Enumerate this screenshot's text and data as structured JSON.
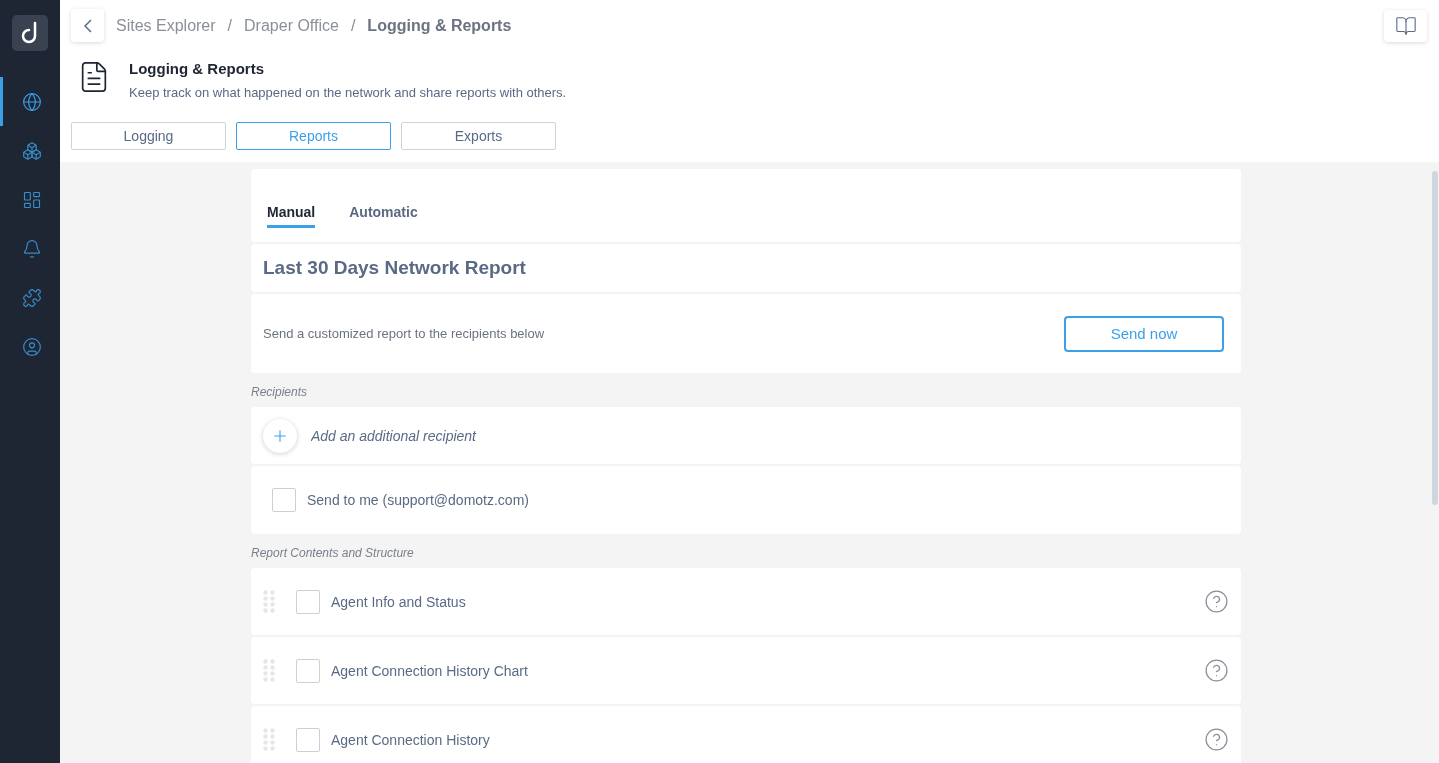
{
  "sidebar": {
    "items": [
      {
        "kind": "globe",
        "selected": true
      },
      {
        "kind": "cubes",
        "selected": false
      },
      {
        "kind": "dashboard",
        "selected": false
      },
      {
        "kind": "bell",
        "selected": false
      },
      {
        "kind": "puzzle",
        "selected": false
      },
      {
        "kind": "user",
        "selected": false
      }
    ]
  },
  "breadcrumb_separator": "/",
  "breadcrumbs": [
    {
      "label": "Sites Explorer",
      "current": false
    },
    {
      "label": "Draper Office",
      "current": false
    },
    {
      "label": "Logging & Reports",
      "current": true
    }
  ],
  "page_header": {
    "title": "Logging & Reports",
    "subtitle": "Keep track on what happened on the network and share reports with others."
  },
  "tabs": [
    {
      "label": "Logging",
      "selected": false
    },
    {
      "label": "Reports",
      "selected": true
    },
    {
      "label": "Exports",
      "selected": false
    }
  ],
  "subtabs": [
    {
      "label": "Manual",
      "selected": true
    },
    {
      "label": "Automatic",
      "selected": false
    }
  ],
  "report": {
    "title": "Last 30 Days Network Report",
    "description": "Send a customized report to the recipients below",
    "send_button": "Send now"
  },
  "recipients": {
    "label": "Recipients",
    "add_placeholder": "Add an additional recipient",
    "send_to_me": {
      "label": "Send to me (support@domotz.com)",
      "checked": false
    }
  },
  "contents": {
    "label": "Report Contents and Structure",
    "items": [
      {
        "label": "Agent Info and Status",
        "checked": false
      },
      {
        "label": "Agent Connection History Chart",
        "checked": false
      },
      {
        "label": "Agent Connection History",
        "checked": false
      }
    ]
  }
}
